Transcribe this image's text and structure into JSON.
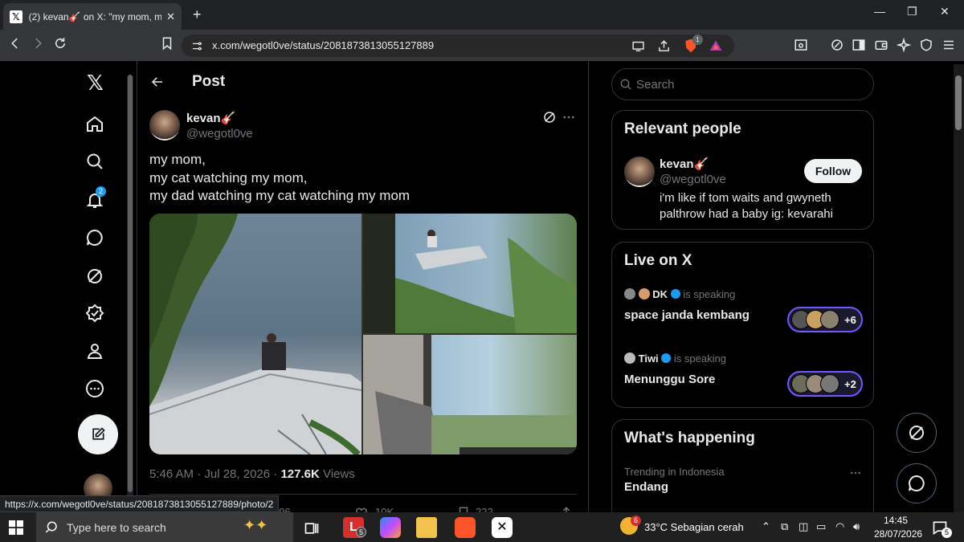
{
  "browser": {
    "tab_title": "(2) kevan🎸 on X: \"my mom, my",
    "url": "x.com/wegotl0ve/status/2081873813055127889",
    "status_url": "https://x.com/wegotl0ve/status/2081873813055127889/photo/2",
    "shield_badge": "1"
  },
  "sidebar": {
    "notification_count": "2"
  },
  "post": {
    "header_title": "Post",
    "author_name": "kevan🎸",
    "author_handle": "@wegotl0ve",
    "text_line1": "my mom,",
    "text_line2": "my cat watching my mom,",
    "text_line3": "my dad watching my cat watching my mom",
    "time": "5:46 AM · Jul 28, 2026 · ",
    "views_count": "127.6K",
    "views_label": " Views",
    "replies": "596",
    "reposts": "10K",
    "likes": "222"
  },
  "right": {
    "search_placeholder": "Search",
    "relevant_title": "Relevant people",
    "person_name": "kevan🎸",
    "person_handle": "@wegotl0ve",
    "follow_label": "Follow",
    "person_bio": "i'm like if tom waits and gwyneth palthrow had a baby ig: kevarahi",
    "live_title": "Live on X",
    "space1_host": "DK",
    "space1_status": "is speaking",
    "space1_title": "space janda kembang",
    "space1_more": "+6",
    "space2_host": "Tiwi",
    "space2_status": "is speaking",
    "space2_title": "Menunggu Sore",
    "space2_more": "+2",
    "happening_title": "What's happening",
    "trend_category": "Trending in Indonesia",
    "trend_name": "Endang"
  },
  "taskbar": {
    "search_placeholder": "Type here to search",
    "weather": "33°C  Sebagian cerah",
    "time": "14:45",
    "date": "28/07/2026",
    "notif_count": "5",
    "app_badge": "5",
    "weather_badge": "6"
  },
  "colors": {
    "accent": "#1d9bf0",
    "space_ring": "#7856ff"
  }
}
